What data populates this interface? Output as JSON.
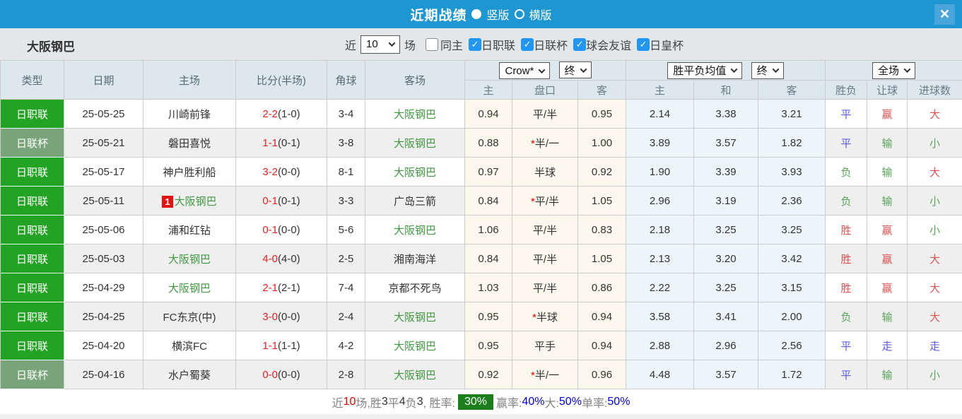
{
  "colors": {
    "titlebar_blue": "#1e96d2",
    "close_button_blue": "#4aa6da",
    "checkbox_blue": "#2196f3",
    "league_badge_green": "#23a323",
    "cup_badge_green": "#79a479",
    "self_team_green": "#3f9a3f",
    "score_red": "#e62222",
    "result_red": "#e05252",
    "result_green": "#57a557",
    "result_blue": "#5b5be6",
    "summary_badge_green": "#1a7e1a",
    "summary_value_blue": "#0000e6"
  },
  "titlebar": {
    "title": "近期战绩",
    "view_options": [
      {
        "label": "竖版",
        "selected": true
      },
      {
        "label": "横版",
        "selected": false
      }
    ],
    "close_icon": "✕"
  },
  "filterbar": {
    "team": "大阪钢巴",
    "near_label": "近",
    "near_value": "10",
    "games_label": "场",
    "checkboxes": [
      {
        "label": "同主",
        "checked": false
      },
      {
        "label": "日职联",
        "checked": true
      },
      {
        "label": "日联杯",
        "checked": true
      },
      {
        "label": "球会友谊",
        "checked": true
      },
      {
        "label": "日皇杯",
        "checked": true
      }
    ]
  },
  "table": {
    "main_headers": [
      "类型",
      "日期",
      "主场",
      "比分(半场)",
      "角球",
      "客场"
    ],
    "dropdowns": {
      "asia_company": "Crow*",
      "asia_stage": "终",
      "europe_metric": "胜平负均值",
      "europe_stage": "终",
      "result_scope": "全场"
    },
    "sub_headers": [
      "主",
      "盘口",
      "客",
      "主",
      "和",
      "客",
      "胜负",
      "让球",
      "进球数"
    ],
    "rows": [
      {
        "league": "日职联",
        "league_type": "league",
        "date": "25-05-25",
        "home": "川崎前锋",
        "home_self": false,
        "home_rank": null,
        "score": "2-2",
        "half": "(1-0)",
        "corner": "3-4",
        "away": "大阪钢巴",
        "away_self": true,
        "asia_home": "0.94",
        "handicap": "平/半",
        "handicap_star": false,
        "asia_away": "0.95",
        "eu_home": "2.14",
        "eu_draw": "3.38",
        "eu_away": "3.21",
        "res_wdl": {
          "t": "平",
          "c": "blue"
        },
        "res_handicap": {
          "t": "赢",
          "c": "red"
        },
        "res_goal": {
          "t": "大",
          "c": "red"
        }
      },
      {
        "league": "日联杯",
        "league_type": "cup",
        "date": "25-05-21",
        "home": "磐田喜悦",
        "home_self": false,
        "home_rank": null,
        "score": "1-1",
        "half": "(0-1)",
        "corner": "3-8",
        "away": "大阪钢巴",
        "away_self": true,
        "asia_home": "0.88",
        "handicap": "半/一",
        "handicap_star": true,
        "asia_away": "1.00",
        "eu_home": "3.89",
        "eu_draw": "3.57",
        "eu_away": "1.82",
        "res_wdl": {
          "t": "平",
          "c": "blue"
        },
        "res_handicap": {
          "t": "输",
          "c": "green"
        },
        "res_goal": {
          "t": "小",
          "c": "green"
        }
      },
      {
        "league": "日职联",
        "league_type": "league",
        "date": "25-05-17",
        "home": "神户胜利船",
        "home_self": false,
        "home_rank": null,
        "score": "3-2",
        "half": "(0-0)",
        "corner": "8-1",
        "away": "大阪钢巴",
        "away_self": true,
        "asia_home": "0.97",
        "handicap": "半球",
        "handicap_star": false,
        "asia_away": "0.92",
        "eu_home": "1.90",
        "eu_draw": "3.39",
        "eu_away": "3.93",
        "res_wdl": {
          "t": "负",
          "c": "green"
        },
        "res_handicap": {
          "t": "输",
          "c": "green"
        },
        "res_goal": {
          "t": "大",
          "c": "red"
        }
      },
      {
        "league": "日职联",
        "league_type": "league",
        "date": "25-05-11",
        "home": "大阪钢巴",
        "home_self": true,
        "home_rank": "1",
        "score": "0-1",
        "half": "(0-1)",
        "corner": "3-3",
        "away": "广岛三箭",
        "away_self": false,
        "asia_home": "0.84",
        "handicap": "平/半",
        "handicap_star": true,
        "asia_away": "1.05",
        "eu_home": "2.96",
        "eu_draw": "3.19",
        "eu_away": "2.36",
        "res_wdl": {
          "t": "负",
          "c": "green"
        },
        "res_handicap": {
          "t": "输",
          "c": "green"
        },
        "res_goal": {
          "t": "小",
          "c": "green"
        }
      },
      {
        "league": "日职联",
        "league_type": "league",
        "date": "25-05-06",
        "home": "浦和红钻",
        "home_self": false,
        "home_rank": null,
        "score": "0-1",
        "half": "(0-0)",
        "corner": "5-6",
        "away": "大阪钢巴",
        "away_self": true,
        "asia_home": "1.06",
        "handicap": "平/半",
        "handicap_star": false,
        "asia_away": "0.83",
        "eu_home": "2.18",
        "eu_draw": "3.25",
        "eu_away": "3.25",
        "res_wdl": {
          "t": "胜",
          "c": "red"
        },
        "res_handicap": {
          "t": "赢",
          "c": "red"
        },
        "res_goal": {
          "t": "小",
          "c": "green"
        }
      },
      {
        "league": "日职联",
        "league_type": "league",
        "date": "25-05-03",
        "home": "大阪钢巴",
        "home_self": true,
        "home_rank": null,
        "score": "4-0",
        "half": "(4-0)",
        "corner": "2-5",
        "away": "湘南海洋",
        "away_self": false,
        "asia_home": "0.84",
        "handicap": "平/半",
        "handicap_star": false,
        "asia_away": "1.05",
        "eu_home": "2.13",
        "eu_draw": "3.20",
        "eu_away": "3.42",
        "res_wdl": {
          "t": "胜",
          "c": "red"
        },
        "res_handicap": {
          "t": "赢",
          "c": "red"
        },
        "res_goal": {
          "t": "大",
          "c": "red"
        }
      },
      {
        "league": "日职联",
        "league_type": "league",
        "date": "25-04-29",
        "home": "大阪钢巴",
        "home_self": true,
        "home_rank": null,
        "score": "2-1",
        "half": "(2-1)",
        "corner": "7-4",
        "away": "京都不死鸟",
        "away_self": false,
        "asia_home": "1.03",
        "handicap": "平/半",
        "handicap_star": false,
        "asia_away": "0.86",
        "eu_home": "2.22",
        "eu_draw": "3.25",
        "eu_away": "3.15",
        "res_wdl": {
          "t": "胜",
          "c": "red"
        },
        "res_handicap": {
          "t": "赢",
          "c": "red"
        },
        "res_goal": {
          "t": "大",
          "c": "red"
        }
      },
      {
        "league": "日职联",
        "league_type": "league",
        "date": "25-04-25",
        "home": "FC东京(中)",
        "home_self": false,
        "home_rank": null,
        "score": "3-0",
        "half": "(0-0)",
        "corner": "2-4",
        "away": "大阪钢巴",
        "away_self": true,
        "asia_home": "0.95",
        "handicap": "半球",
        "handicap_star": true,
        "asia_away": "0.94",
        "eu_home": "3.58",
        "eu_draw": "3.41",
        "eu_away": "2.00",
        "res_wdl": {
          "t": "负",
          "c": "green"
        },
        "res_handicap": {
          "t": "输",
          "c": "green"
        },
        "res_goal": {
          "t": "大",
          "c": "red"
        }
      },
      {
        "league": "日职联",
        "league_type": "league",
        "date": "25-04-20",
        "home": "横滨FC",
        "home_self": false,
        "home_rank": null,
        "score": "1-1",
        "half": "(1-1)",
        "corner": "4-2",
        "away": "大阪钢巴",
        "away_self": true,
        "asia_home": "0.95",
        "handicap": "平手",
        "handicap_star": false,
        "asia_away": "0.94",
        "eu_home": "2.88",
        "eu_draw": "2.96",
        "eu_away": "2.56",
        "res_wdl": {
          "t": "平",
          "c": "blue"
        },
        "res_handicap": {
          "t": "走",
          "c": "blue"
        },
        "res_goal": {
          "t": "走",
          "c": "blue"
        }
      },
      {
        "league": "日联杯",
        "league_type": "cup",
        "date": "25-04-16",
        "home": "水户蜀葵",
        "home_self": false,
        "home_rank": null,
        "score": "0-0",
        "half": "(0-0)",
        "corner": "2-8",
        "away": "大阪钢巴",
        "away_self": true,
        "asia_home": "0.92",
        "handicap": "半/一",
        "handicap_star": true,
        "asia_away": "0.96",
        "eu_home": "4.48",
        "eu_draw": "3.57",
        "eu_away": "1.72",
        "res_wdl": {
          "t": "平",
          "c": "blue"
        },
        "res_handicap": {
          "t": "输",
          "c": "green"
        },
        "res_goal": {
          "t": "小",
          "c": "green"
        }
      }
    ]
  },
  "summary": {
    "parts": [
      {
        "text": "近",
        "style": "label"
      },
      {
        "text": "10",
        "style": "red"
      },
      {
        "text": "场,胜",
        "style": "label"
      },
      {
        "text": "3",
        "style": "num"
      },
      {
        "text": "平",
        "style": "label"
      },
      {
        "text": "4",
        "style": "num"
      },
      {
        "text": "负",
        "style": "label"
      },
      {
        "text": "3",
        "style": "num"
      },
      {
        "text": ", 胜率: ",
        "style": "label"
      },
      {
        "text": "30%",
        "style": "badge"
      },
      {
        "text": " 赢率:",
        "style": "label"
      },
      {
        "text": "40%",
        "style": "blue"
      },
      {
        "text": " 大:",
        "style": "label"
      },
      {
        "text": "50%",
        "style": "blue"
      },
      {
        "text": " 单率:",
        "style": "label"
      },
      {
        "text": "50%",
        "style": "blue"
      }
    ]
  }
}
